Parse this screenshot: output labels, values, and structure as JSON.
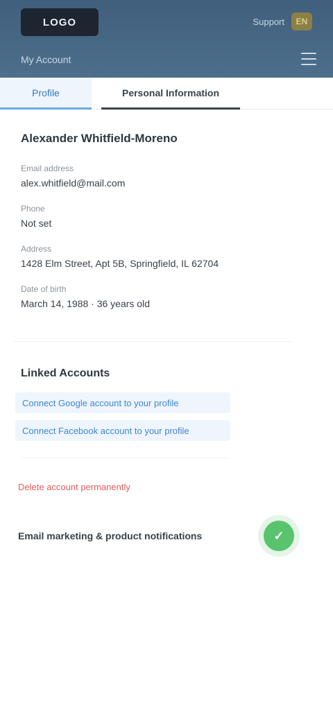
{
  "header": {
    "logo_text": "LOGO",
    "link_text": "Support",
    "badge_text": "EN",
    "subtitle": "My Account"
  },
  "tabs": [
    {
      "label": "Profile"
    },
    {
      "label": "Personal Information"
    }
  ],
  "profile": {
    "name": "Alexander Whitfield-Moreno",
    "fields": [
      {
        "label": "Email address",
        "value": "alex.whitfield@mail.com"
      },
      {
        "label": "Phone",
        "value": "Not set"
      },
      {
        "label": "Address",
        "value": "1428 Elm Street, Apt 5B, Springfield, IL 62704"
      },
      {
        "label": "Date of birth",
        "value": "March 14, 1988 · 36 years old"
      }
    ]
  },
  "accounts": {
    "title": "Linked Accounts",
    "links": [
      {
        "label": "Connect Google account to your profile"
      },
      {
        "label": "Connect Facebook account to your profile"
      }
    ]
  },
  "danger": {
    "delete_label": "Delete account permanently"
  },
  "notifications": {
    "label": "Email marketing & product notifications",
    "toggle_state": "on",
    "toggle_glyph": "✓"
  }
}
